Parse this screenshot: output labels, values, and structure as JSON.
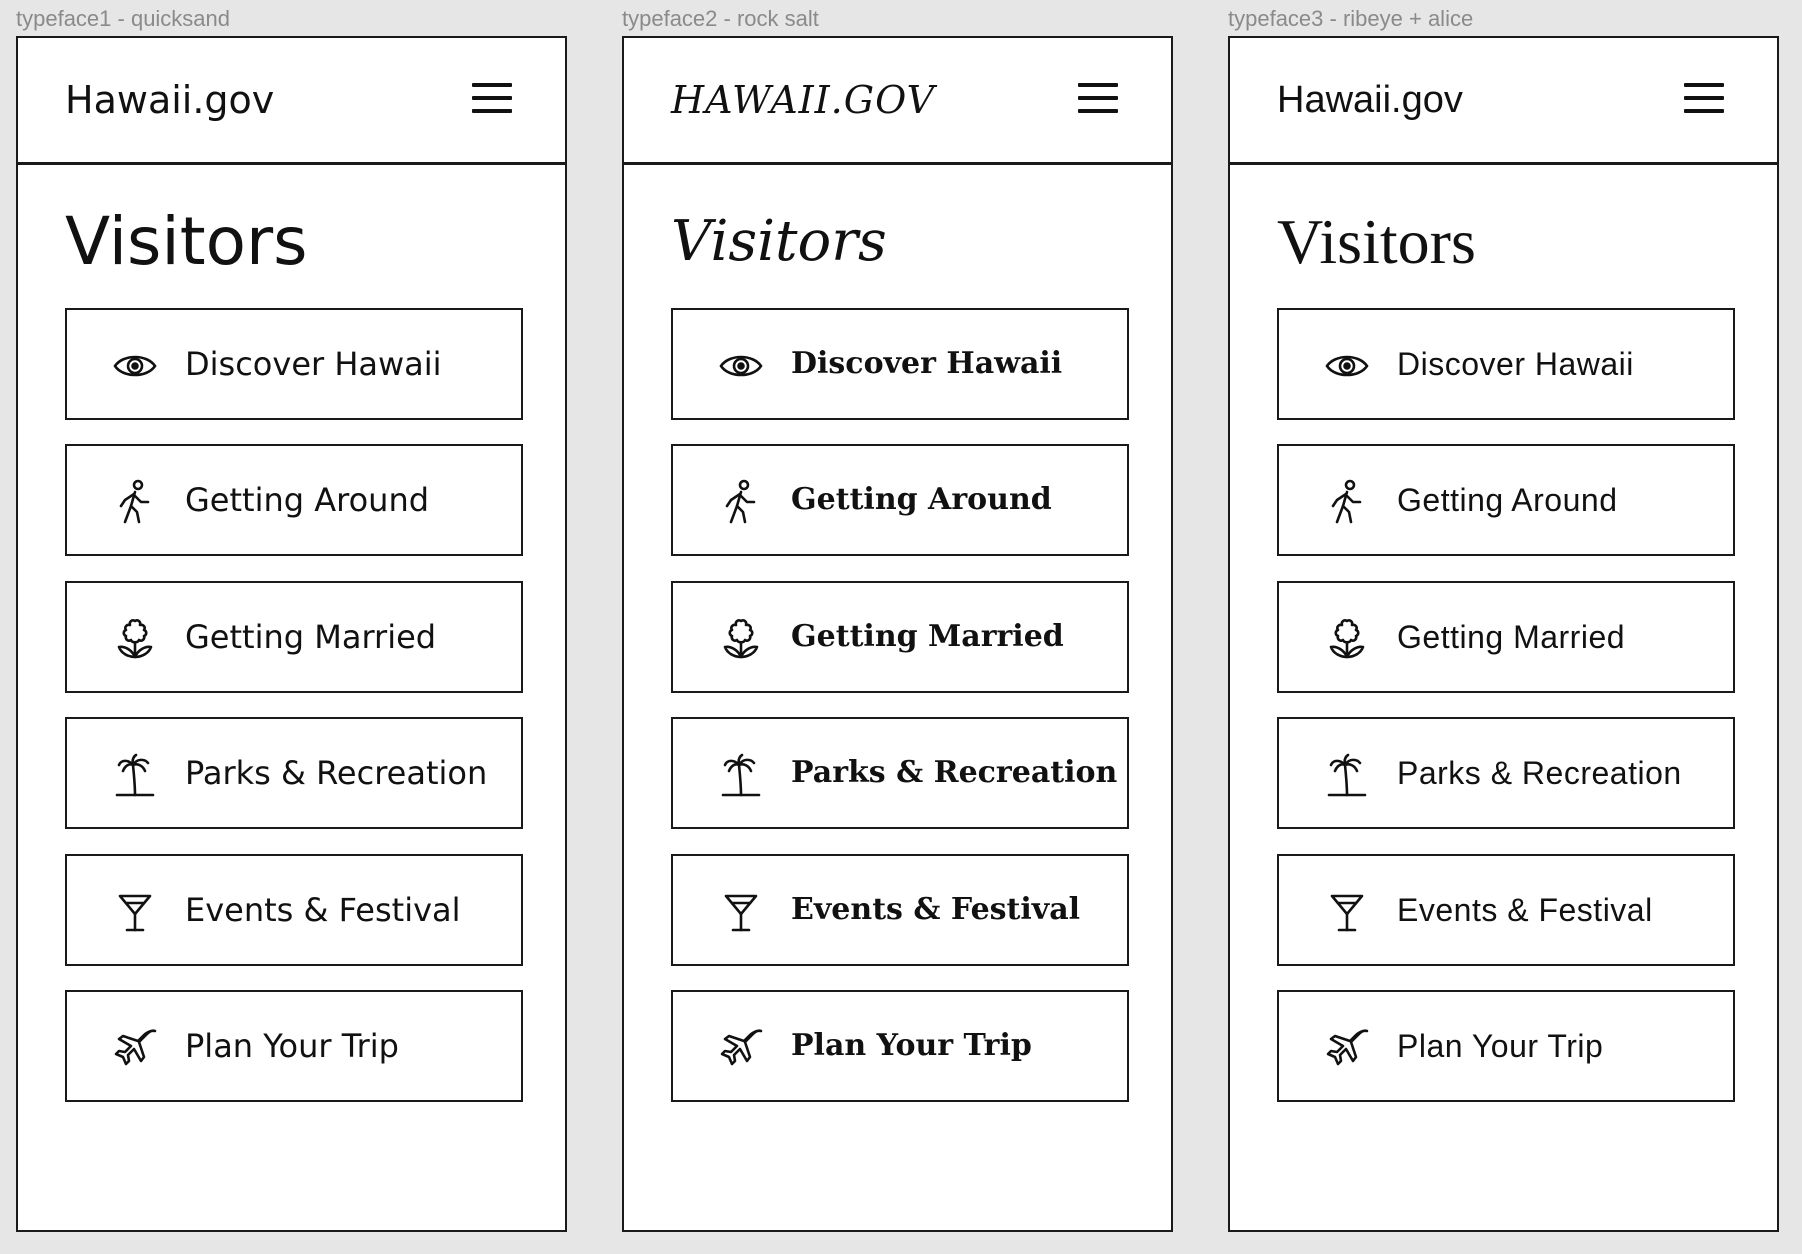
{
  "frames": [
    {
      "label": "typeface1 - quicksand",
      "brand": "Hawaii.gov",
      "heading": "Visitors",
      "items": [
        {
          "label": "Discover Hawaii",
          "icon": "eye-icon"
        },
        {
          "label": "Getting Around",
          "icon": "walking-person-icon"
        },
        {
          "label": "Getting Married",
          "icon": "flower-icon"
        },
        {
          "label": "Parks & Recreation",
          "icon": "palm-tree-icon"
        },
        {
          "label": "Events & Festival",
          "icon": "cocktail-glass-icon"
        },
        {
          "label": "Plan Your Trip",
          "icon": "airplane-icon"
        }
      ]
    },
    {
      "label": "typeface2 - rock salt",
      "brand": "HAWAII.GOV",
      "heading": "Visitors",
      "items": [
        {
          "label": "Discover Hawaii",
          "icon": "eye-icon"
        },
        {
          "label": "Getting Around",
          "icon": "walking-person-icon"
        },
        {
          "label": "Getting Married",
          "icon": "flower-icon"
        },
        {
          "label": "Parks & Recreation",
          "icon": "palm-tree-icon"
        },
        {
          "label": "Events & Festival",
          "icon": "cocktail-glass-icon"
        },
        {
          "label": "Plan Your Trip",
          "icon": "airplane-icon"
        }
      ]
    },
    {
      "label": "typeface3 - ribeye + alice",
      "brand": "Hawaii.gov",
      "heading": "Visitors",
      "items": [
        {
          "label": "Discover Hawaii",
          "icon": "eye-icon"
        },
        {
          "label": "Getting Around",
          "icon": "walking-person-icon"
        },
        {
          "label": "Getting Married",
          "icon": "flower-icon"
        },
        {
          "label": "Parks & Recreation",
          "icon": "palm-tree-icon"
        },
        {
          "label": "Events & Festival",
          "icon": "cocktail-glass-icon"
        },
        {
          "label": "Plan Your Trip",
          "icon": "airplane-icon"
        }
      ]
    }
  ],
  "colors": {
    "background": "#e6e6e6",
    "frame": "#ffffff",
    "ink": "#111111",
    "caption": "#8a8a8a"
  }
}
